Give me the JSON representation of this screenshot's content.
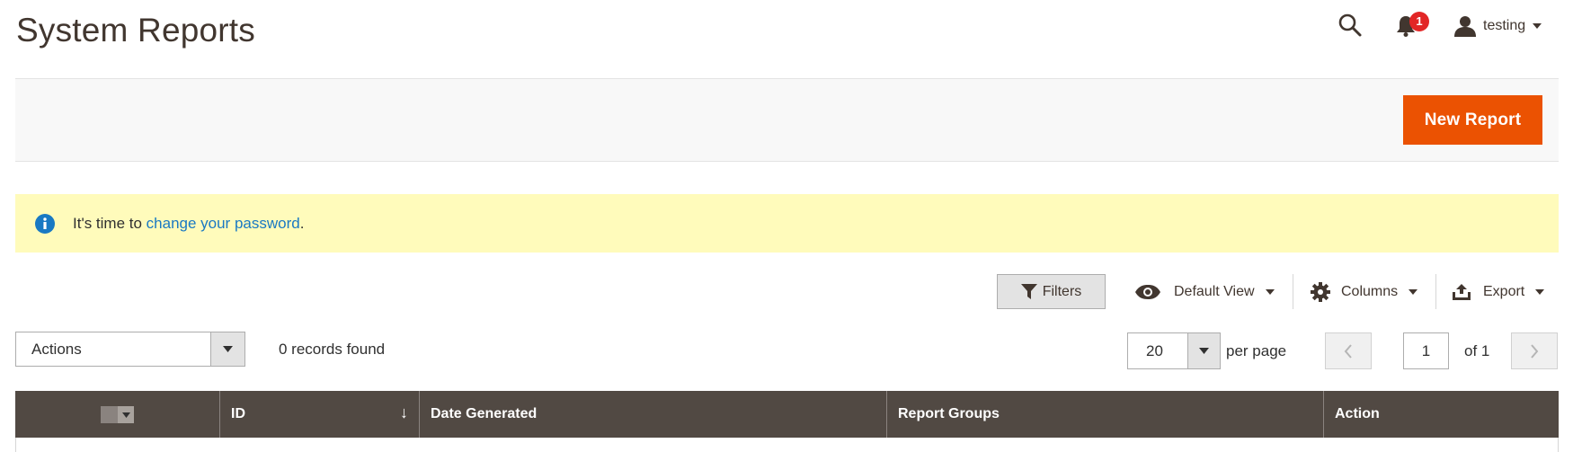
{
  "header": {
    "title": "System Reports",
    "notification_count": "1",
    "user_name": "testing"
  },
  "action_bar": {
    "new_report_label": "New Report"
  },
  "message": {
    "prefix": "It's time to ",
    "link_text": "change your password",
    "suffix": "."
  },
  "toolbar": {
    "filters_label": "Filters",
    "view_label": "Default View",
    "columns_label": "Columns",
    "export_label": "Export"
  },
  "actions": {
    "select_label": "Actions",
    "records_found": "0 records found"
  },
  "pagination": {
    "per_page_value": "20",
    "per_page_label": "per page",
    "current_page": "1",
    "of_label": "of 1"
  },
  "grid": {
    "columns": [
      "ID",
      "Date Generated",
      "Report Groups",
      "Action"
    ]
  },
  "colors": {
    "accent": "#eb5202",
    "grid_header": "#514943",
    "message_bg": "#fffbbb",
    "link": "#1979c3",
    "badge": "#e22626"
  }
}
